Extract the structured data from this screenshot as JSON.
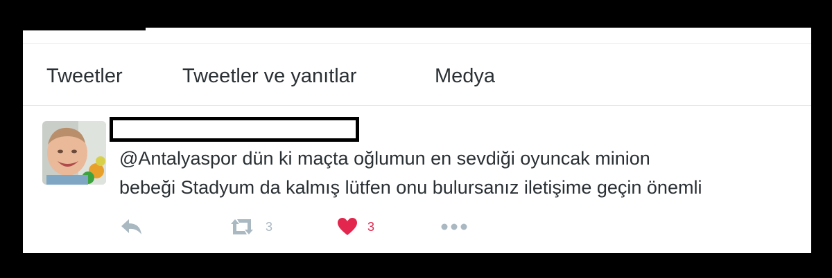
{
  "profile": {
    "tabs": [
      {
        "label": "Tweetler"
      },
      {
        "label": "Tweetler ve yanıtlar"
      },
      {
        "label": "Medya"
      }
    ]
  },
  "tweet": {
    "text_line1": "@Antalyaspor dün ki maçta oğlumun en sevdiği oyuncak minion",
    "text_line2": "bebeği Stadyum da kalmış lütfen onu bulursanız iletişime geçin önemli",
    "actions": {
      "reply_icon": "reply-icon",
      "retweet_icon": "retweet-icon",
      "retweet_count": "3",
      "like_icon": "heart-icon",
      "like_count": "3",
      "more_icon": "more-icon"
    }
  },
  "colors": {
    "text": "#292f33",
    "muted_icon": "#aab8c2",
    "like": "#e2264d",
    "border": "#e1e8ed"
  }
}
